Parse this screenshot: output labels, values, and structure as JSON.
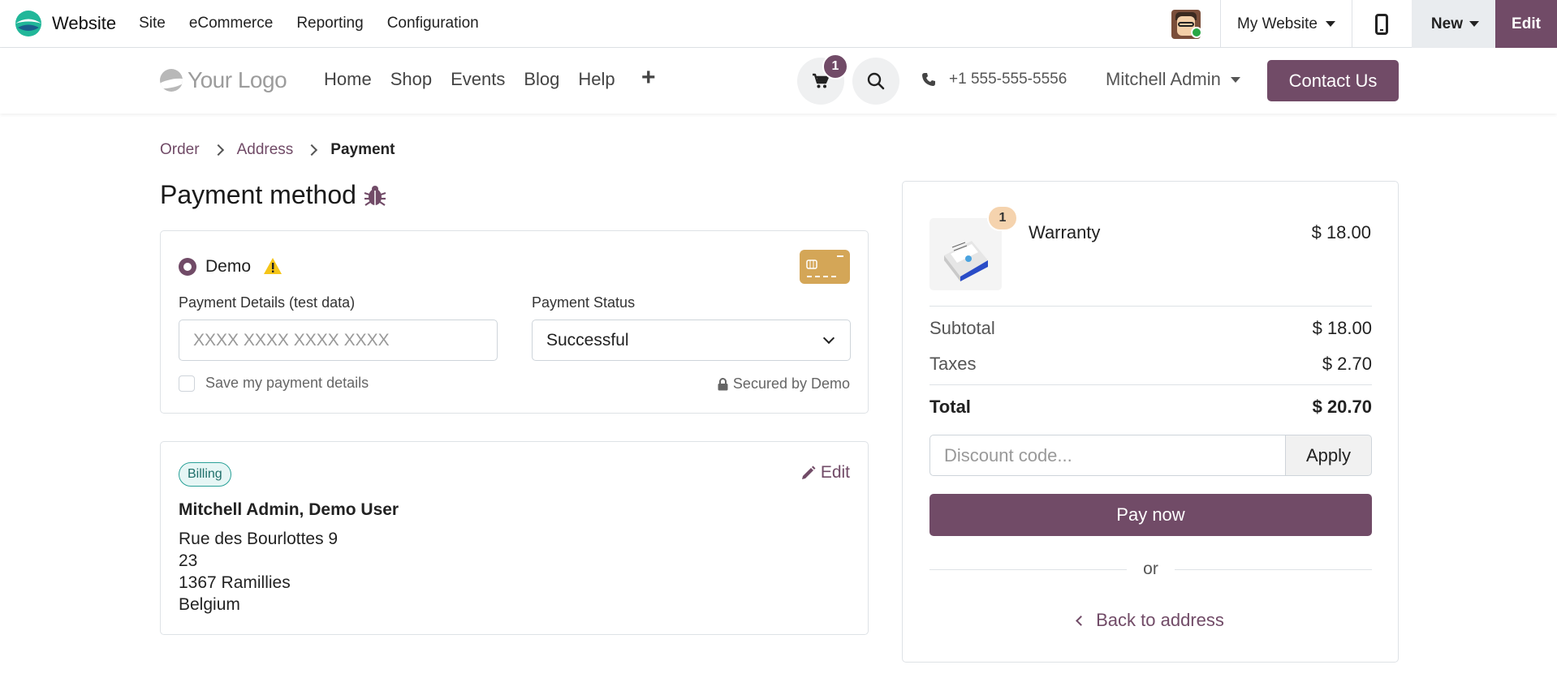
{
  "adminbar": {
    "app_name": "Website",
    "menu": [
      "Site",
      "eCommerce",
      "Reporting",
      "Configuration"
    ],
    "website_selector": "My Website",
    "new_label": "New",
    "edit_label": "Edit",
    "accent_color": "#714b67"
  },
  "header": {
    "logo_text": "Your Logo",
    "nav": [
      "Home",
      "Shop",
      "Events",
      "Blog",
      "Help"
    ],
    "add_icon": "+",
    "cart_count": "1",
    "phone": "+1 555-555-5556",
    "user": "Mitchell Admin",
    "contact_label": "Contact Us"
  },
  "breadcrumb": {
    "items": [
      "Order",
      "Address"
    ],
    "current": "Payment"
  },
  "page_title": "Payment method",
  "payment": {
    "provider": "Demo",
    "details_label": "Payment Details (test data)",
    "card_placeholder": "XXXX XXXX XXXX XXXX",
    "status_label": "Payment Status",
    "status_value": "Successful",
    "save_label": "Save my payment details",
    "secured_label": "Secured by Demo"
  },
  "billing": {
    "badge": "Billing",
    "edit_label": "Edit",
    "name": "Mitchell Admin, Demo User",
    "address_lines": [
      "Rue des Bourlottes 9",
      "23",
      "1367 Ramillies",
      "Belgium"
    ]
  },
  "summary": {
    "product": {
      "name": "Warranty",
      "price": "$ 18.00",
      "qty": "1"
    },
    "subtotal_label": "Subtotal",
    "subtotal": "$ 18.00",
    "taxes_label": "Taxes",
    "taxes": "$ 2.70",
    "total_label": "Total",
    "total": "$ 20.70",
    "discount_placeholder": "Discount code...",
    "apply_label": "Apply",
    "pay_label": "Pay now",
    "or_label": "or",
    "back_label": "Back to address"
  }
}
